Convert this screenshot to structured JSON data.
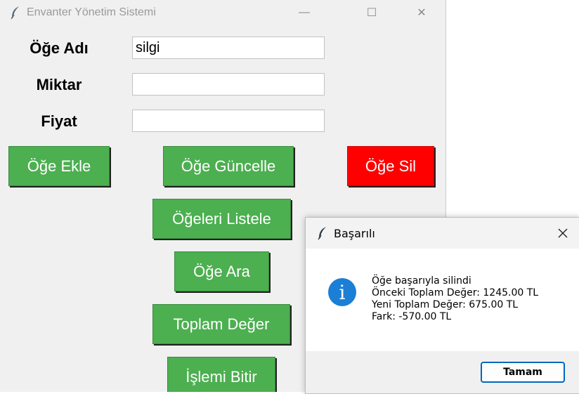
{
  "main_window": {
    "title": "Envanter Yönetim Sistemi",
    "controls": {
      "minimize": "—",
      "maximize": "☐",
      "close": "✕"
    },
    "form": {
      "item_name_label": "Öğe Adı",
      "item_name_value": "silgi",
      "quantity_label": "Miktar",
      "quantity_value": "",
      "price_label": "Fiyat",
      "price_value": ""
    },
    "buttons": {
      "add": "Öğe Ekle",
      "update": "Öğe Güncelle",
      "delete": "Öğe Sil",
      "list": "Öğeleri Listele",
      "search": "Öğe Ara",
      "total": "Toplam Değer",
      "finish": "İşlemi Bitir"
    },
    "colors": {
      "button_green": "#4caf50",
      "button_red": "#ff0000"
    }
  },
  "dialog": {
    "title": "Başarılı",
    "icon": "info-icon",
    "message_lines": [
      "Öğe başarıyla silindi",
      "Önceki Toplam Değer: 1245.00 TL",
      "Yeni Toplam Değer: 675.00 TL",
      "Fark: -570.00 TL"
    ],
    "ok_label": "Tamam"
  }
}
